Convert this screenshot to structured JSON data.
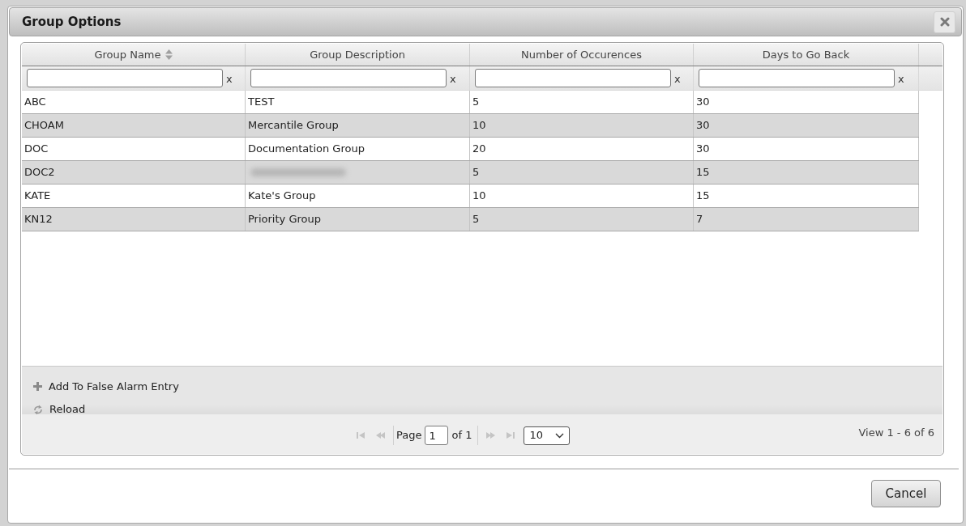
{
  "dialog": {
    "title": "Group Options"
  },
  "grid": {
    "columns": [
      {
        "label": "Group Name",
        "sortable": true,
        "clear_label": "x"
      },
      {
        "label": "Group Description",
        "sortable": false,
        "clear_label": "x"
      },
      {
        "label": "Number of Occurences",
        "sortable": false,
        "clear_label": "x"
      },
      {
        "label": "Days to Go Back",
        "sortable": false,
        "clear_label": "x"
      }
    ],
    "rows": [
      {
        "group_name": "ABC",
        "description": "TEST",
        "occurrences": "5",
        "days_back": "30"
      },
      {
        "group_name": "CHOAM",
        "description": "Mercantile Group",
        "occurrences": "10",
        "days_back": "30"
      },
      {
        "group_name": "DOC",
        "description": "Documentation Group",
        "occurrences": "20",
        "days_back": "30"
      },
      {
        "group_name": "DOC2",
        "description_blurred": true,
        "occurrences": "5",
        "days_back": "15"
      },
      {
        "group_name": "KATE",
        "description": "Kate's Group",
        "occurrences": "10",
        "days_back": "15"
      },
      {
        "group_name": "KN12",
        "description": "Priority Group",
        "occurrences": "5",
        "days_back": "7"
      }
    ]
  },
  "toolbar": {
    "actions": [
      {
        "kind": "add",
        "label": "Add To False Alarm Entry"
      },
      {
        "kind": "reload",
        "label": "Reload"
      }
    ]
  },
  "pager": {
    "nav_before": [
      {
        "kind": "first",
        "disabled": true
      },
      {
        "kind": "prev",
        "disabled": true
      }
    ],
    "page_label": "Page",
    "page_value": "1",
    "of_label": "of 1",
    "nav_after": [
      {
        "kind": "next",
        "disabled": true
      },
      {
        "kind": "last",
        "disabled": true
      }
    ],
    "rows_per_page": "10",
    "record_info": "View 1 - 6 of 6"
  },
  "footer": {
    "buttons": [
      "Cancel"
    ]
  }
}
